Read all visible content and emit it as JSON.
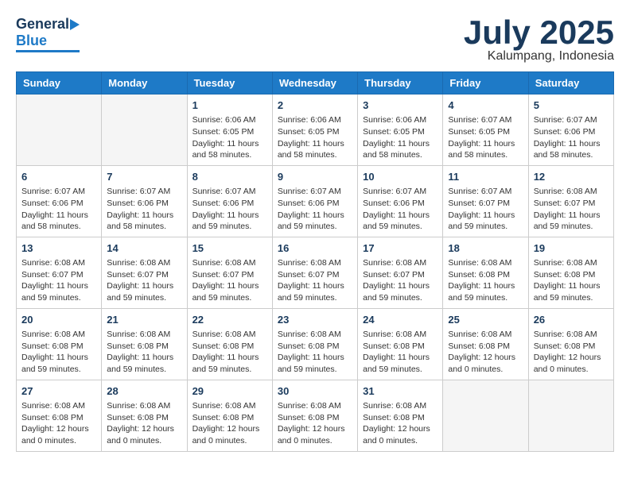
{
  "header": {
    "logo": {
      "general": "General",
      "blue": "Blue"
    },
    "title": "July 2025",
    "location": "Kalumpang, Indonesia"
  },
  "calendar": {
    "days_of_week": [
      "Sunday",
      "Monday",
      "Tuesday",
      "Wednesday",
      "Thursday",
      "Friday",
      "Saturday"
    ],
    "weeks": [
      [
        {
          "day": "",
          "info": ""
        },
        {
          "day": "",
          "info": ""
        },
        {
          "day": "1",
          "info": "Sunrise: 6:06 AM\nSunset: 6:05 PM\nDaylight: 11 hours and 58 minutes."
        },
        {
          "day": "2",
          "info": "Sunrise: 6:06 AM\nSunset: 6:05 PM\nDaylight: 11 hours and 58 minutes."
        },
        {
          "day": "3",
          "info": "Sunrise: 6:06 AM\nSunset: 6:05 PM\nDaylight: 11 hours and 58 minutes."
        },
        {
          "day": "4",
          "info": "Sunrise: 6:07 AM\nSunset: 6:05 PM\nDaylight: 11 hours and 58 minutes."
        },
        {
          "day": "5",
          "info": "Sunrise: 6:07 AM\nSunset: 6:06 PM\nDaylight: 11 hours and 58 minutes."
        }
      ],
      [
        {
          "day": "6",
          "info": "Sunrise: 6:07 AM\nSunset: 6:06 PM\nDaylight: 11 hours and 58 minutes."
        },
        {
          "day": "7",
          "info": "Sunrise: 6:07 AM\nSunset: 6:06 PM\nDaylight: 11 hours and 58 minutes."
        },
        {
          "day": "8",
          "info": "Sunrise: 6:07 AM\nSunset: 6:06 PM\nDaylight: 11 hours and 59 minutes."
        },
        {
          "day": "9",
          "info": "Sunrise: 6:07 AM\nSunset: 6:06 PM\nDaylight: 11 hours and 59 minutes."
        },
        {
          "day": "10",
          "info": "Sunrise: 6:07 AM\nSunset: 6:06 PM\nDaylight: 11 hours and 59 minutes."
        },
        {
          "day": "11",
          "info": "Sunrise: 6:07 AM\nSunset: 6:07 PM\nDaylight: 11 hours and 59 minutes."
        },
        {
          "day": "12",
          "info": "Sunrise: 6:08 AM\nSunset: 6:07 PM\nDaylight: 11 hours and 59 minutes."
        }
      ],
      [
        {
          "day": "13",
          "info": "Sunrise: 6:08 AM\nSunset: 6:07 PM\nDaylight: 11 hours and 59 minutes."
        },
        {
          "day": "14",
          "info": "Sunrise: 6:08 AM\nSunset: 6:07 PM\nDaylight: 11 hours and 59 minutes."
        },
        {
          "day": "15",
          "info": "Sunrise: 6:08 AM\nSunset: 6:07 PM\nDaylight: 11 hours and 59 minutes."
        },
        {
          "day": "16",
          "info": "Sunrise: 6:08 AM\nSunset: 6:07 PM\nDaylight: 11 hours and 59 minutes."
        },
        {
          "day": "17",
          "info": "Sunrise: 6:08 AM\nSunset: 6:07 PM\nDaylight: 11 hours and 59 minutes."
        },
        {
          "day": "18",
          "info": "Sunrise: 6:08 AM\nSunset: 6:08 PM\nDaylight: 11 hours and 59 minutes."
        },
        {
          "day": "19",
          "info": "Sunrise: 6:08 AM\nSunset: 6:08 PM\nDaylight: 11 hours and 59 minutes."
        }
      ],
      [
        {
          "day": "20",
          "info": "Sunrise: 6:08 AM\nSunset: 6:08 PM\nDaylight: 11 hours and 59 minutes."
        },
        {
          "day": "21",
          "info": "Sunrise: 6:08 AM\nSunset: 6:08 PM\nDaylight: 11 hours and 59 minutes."
        },
        {
          "day": "22",
          "info": "Sunrise: 6:08 AM\nSunset: 6:08 PM\nDaylight: 11 hours and 59 minutes."
        },
        {
          "day": "23",
          "info": "Sunrise: 6:08 AM\nSunset: 6:08 PM\nDaylight: 11 hours and 59 minutes."
        },
        {
          "day": "24",
          "info": "Sunrise: 6:08 AM\nSunset: 6:08 PM\nDaylight: 11 hours and 59 minutes."
        },
        {
          "day": "25",
          "info": "Sunrise: 6:08 AM\nSunset: 6:08 PM\nDaylight: 12 hours and 0 minutes."
        },
        {
          "day": "26",
          "info": "Sunrise: 6:08 AM\nSunset: 6:08 PM\nDaylight: 12 hours and 0 minutes."
        }
      ],
      [
        {
          "day": "27",
          "info": "Sunrise: 6:08 AM\nSunset: 6:08 PM\nDaylight: 12 hours and 0 minutes."
        },
        {
          "day": "28",
          "info": "Sunrise: 6:08 AM\nSunset: 6:08 PM\nDaylight: 12 hours and 0 minutes."
        },
        {
          "day": "29",
          "info": "Sunrise: 6:08 AM\nSunset: 6:08 PM\nDaylight: 12 hours and 0 minutes."
        },
        {
          "day": "30",
          "info": "Sunrise: 6:08 AM\nSunset: 6:08 PM\nDaylight: 12 hours and 0 minutes."
        },
        {
          "day": "31",
          "info": "Sunrise: 6:08 AM\nSunset: 6:08 PM\nDaylight: 12 hours and 0 minutes."
        },
        {
          "day": "",
          "info": ""
        },
        {
          "day": "",
          "info": ""
        }
      ]
    ]
  }
}
